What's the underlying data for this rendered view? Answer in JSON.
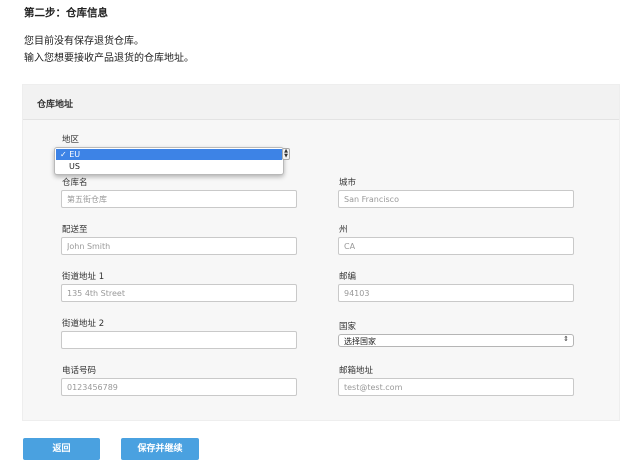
{
  "step_title": "第二步：仓库信息",
  "intro_line1": "您目前没有保存退货仓库。",
  "intro_line2": "输入您想要接收产品退货的仓库地址。",
  "panel": {
    "title": "仓库地址"
  },
  "region": {
    "label": "地区",
    "options": [
      "EU",
      "US"
    ],
    "selected": "EU",
    "check_mark": "✓"
  },
  "fields": {
    "warehouse_name": {
      "label": "仓库名",
      "placeholder": "第五街仓库"
    },
    "city": {
      "label": "城市",
      "placeholder": "San Francisco"
    },
    "ship_to": {
      "label": "配送至",
      "placeholder": "John Smith"
    },
    "state": {
      "label": "州",
      "placeholder": "CA"
    },
    "street1": {
      "label": "街道地址 1",
      "placeholder": "135 4th Street"
    },
    "zip": {
      "label": "邮编",
      "placeholder": "94103"
    },
    "street2": {
      "label": "街道地址 2",
      "placeholder": ""
    },
    "country": {
      "label": "国家",
      "value": "选择国家"
    },
    "phone": {
      "label": "电话号码",
      "placeholder": "0123456789"
    },
    "email": {
      "label": "邮箱地址",
      "placeholder": "test@test.com"
    }
  },
  "buttons": {
    "back": "返回",
    "save_continue": "保存并继续"
  },
  "colors": {
    "accent": "#4aa1e0",
    "selected_option": "#3d83e6",
    "panel_bg": "#f7f7f7"
  },
  "icons": {
    "select_arrow": "up-down-chevron-icon"
  }
}
